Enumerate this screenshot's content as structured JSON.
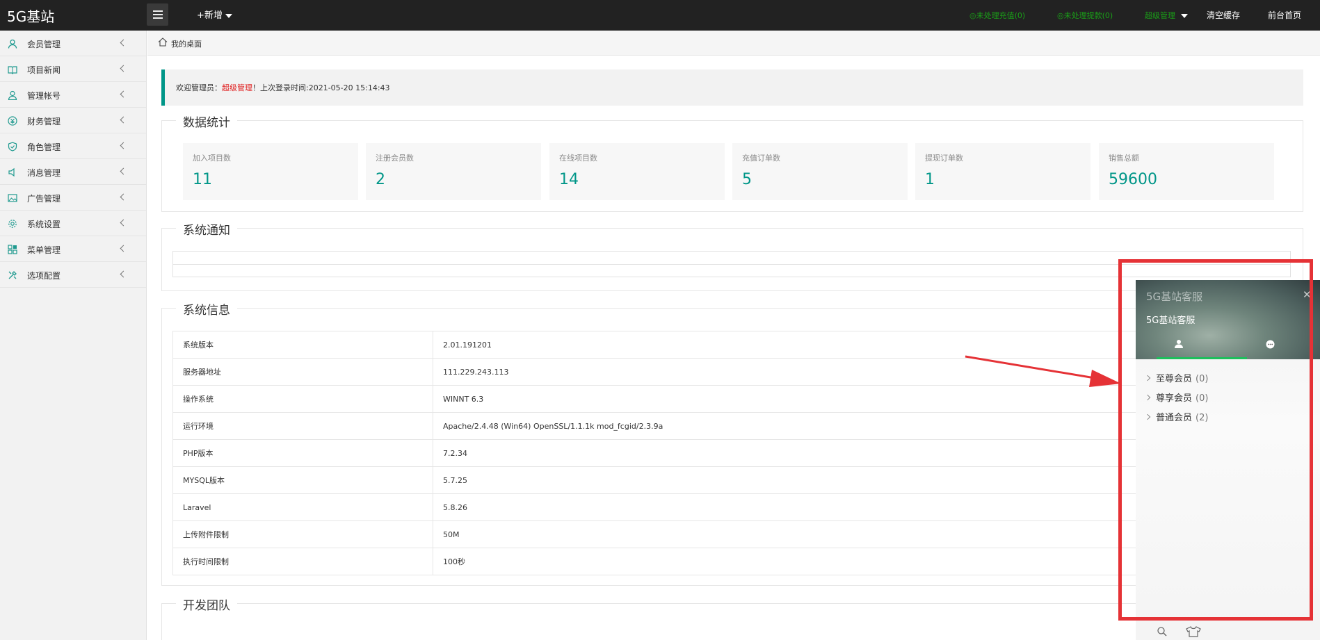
{
  "header": {
    "logo": "5G基站",
    "add_new": "+新增",
    "unprocessed_recharge": "◎未处理充值(0)",
    "unprocessed_withdraw": "◎未处理提款(0)",
    "admin_menu": "超级管理",
    "clear_cache": "清空缓存",
    "frontend_home": "前台首页"
  },
  "sidebar": {
    "items": [
      {
        "label": "会员管理",
        "icon": "user-icon"
      },
      {
        "label": "项目新闻",
        "icon": "book-icon"
      },
      {
        "label": "管理帐号",
        "icon": "account-icon"
      },
      {
        "label": "财务管理",
        "icon": "finance-icon"
      },
      {
        "label": "角色管理",
        "icon": "shield-icon"
      },
      {
        "label": "消息管理",
        "icon": "speaker-icon"
      },
      {
        "label": "广告管理",
        "icon": "image-icon"
      },
      {
        "label": "系统设置",
        "icon": "gear-icon"
      },
      {
        "label": "菜单管理",
        "icon": "grid-icon"
      },
      {
        "label": "选项配置",
        "icon": "tools-icon"
      }
    ]
  },
  "breadcrumb": {
    "label": "我的桌面"
  },
  "welcome": {
    "prefix": "欢迎管理员：",
    "admin": "超级管理",
    "suffix": "！上次登录时间:2021-05-20 15:14:43"
  },
  "stats": {
    "legend": "数据统计",
    "cards": [
      {
        "label": "加入项目数",
        "value": "11"
      },
      {
        "label": "注册会员数",
        "value": "2"
      },
      {
        "label": "在线项目数",
        "value": "14"
      },
      {
        "label": "充值订单数",
        "value": "5"
      },
      {
        "label": "提现订单数",
        "value": "1"
      },
      {
        "label": "销售总额",
        "value": "59600"
      }
    ]
  },
  "notice": {
    "legend": "系统通知"
  },
  "sysinfo": {
    "legend": "系统信息",
    "rows": [
      {
        "key": "系统版本",
        "value": "2.01.191201"
      },
      {
        "key": "服务器地址",
        "value": "111.229.243.113"
      },
      {
        "key": "操作系统",
        "value": "WINNT 6.3"
      },
      {
        "key": "运行环境",
        "value": "Apache/2.4.48 (Win64) OpenSSL/1.1.1k mod_fcgid/2.3.9a"
      },
      {
        "key": "PHP版本",
        "value": "7.2.34"
      },
      {
        "key": "MYSQL版本",
        "value": "5.7.25"
      },
      {
        "key": "Laravel",
        "value": "5.8.26"
      },
      {
        "key": "上传附件限制",
        "value": "50M"
      },
      {
        "key": "执行时间限制",
        "value": "100秒"
      }
    ]
  },
  "team": {
    "legend": "开发团队"
  },
  "chat": {
    "title": "5G基站客服",
    "subtitle": "5G基站客服",
    "close": "✕",
    "groups": [
      {
        "name": "至尊会员",
        "count": "(0)"
      },
      {
        "name": "尊享会员",
        "count": "(0)"
      },
      {
        "name": "普通会员",
        "count": "(2)"
      }
    ]
  }
}
